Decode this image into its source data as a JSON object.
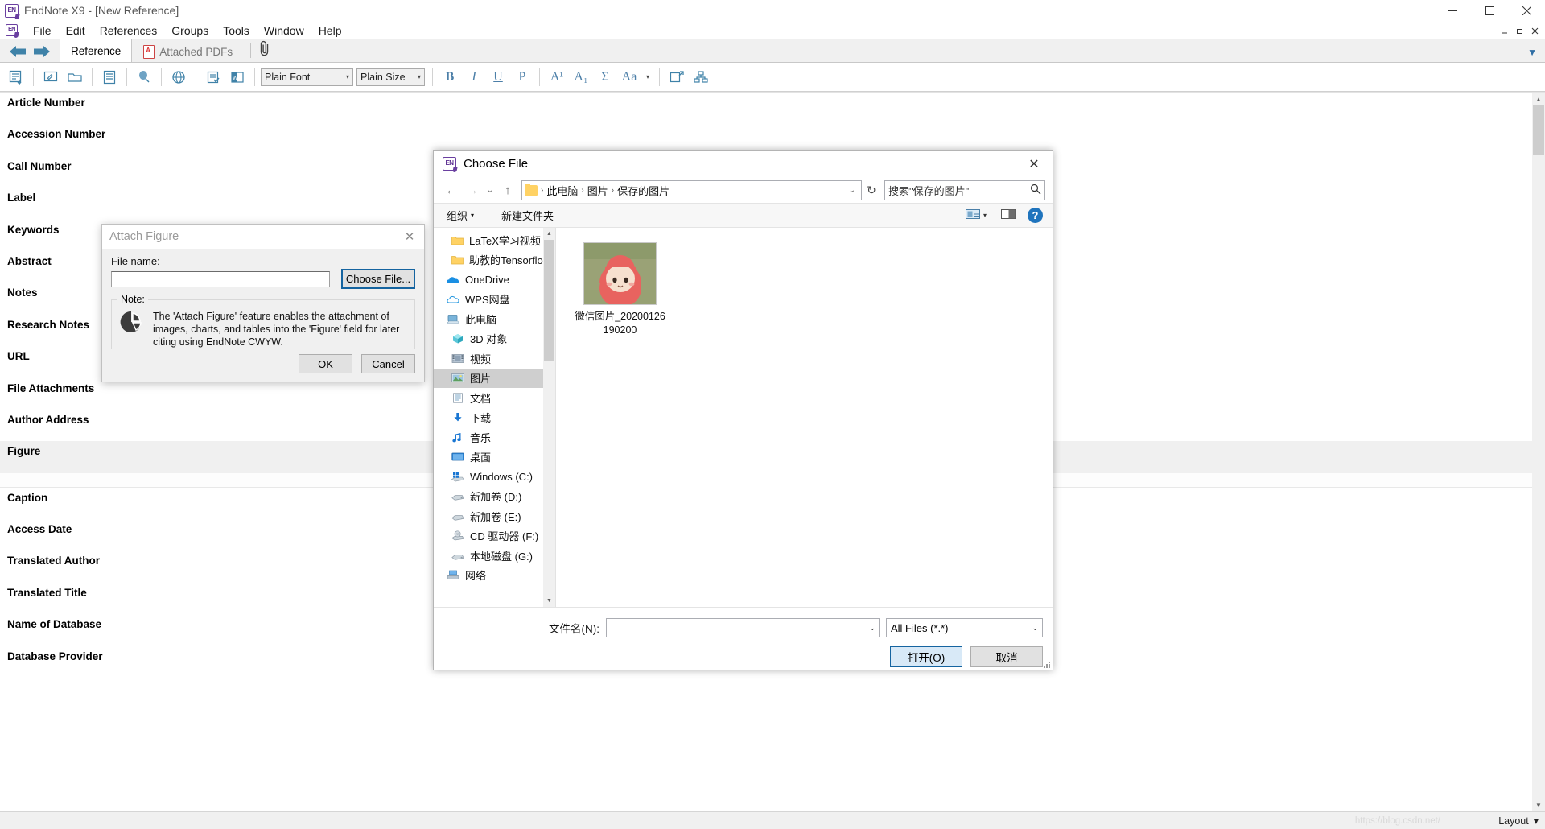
{
  "window": {
    "title": "EndNote X9 - [New Reference]",
    "app_logo": "EN",
    "controls": {
      "minimize": "—",
      "maximize": "❐",
      "close": "✕"
    },
    "mdi_controls": {
      "minimize": "—",
      "restore": "❐",
      "close": "✕"
    }
  },
  "menu": {
    "items": [
      "File",
      "Edit",
      "References",
      "Groups",
      "Tools",
      "Window",
      "Help"
    ]
  },
  "tabstrip": {
    "back": "back-arrow",
    "forward": "forward-arrow",
    "tabs": [
      {
        "label": "Reference",
        "active": true
      },
      {
        "label": "Attached PDFs",
        "active": false
      }
    ],
    "attachment_icon": "paperclip-icon",
    "collapse": "▼"
  },
  "toolbar": {
    "font_combo": {
      "value": "Plain Font"
    },
    "size_combo": {
      "value": "Plain Size"
    },
    "text_buttons": [
      "B",
      "I",
      "U",
      "P",
      "A¹",
      "A₁",
      "Σ",
      "Aa"
    ],
    "dropdown_caret": "▾"
  },
  "reference_fields": [
    "Article Number",
    "Accession Number",
    "Call Number",
    "Label",
    "Keywords",
    "Abstract",
    "Notes",
    "Research Notes",
    "URL",
    "File Attachments",
    "Author Address",
    "Figure",
    "Caption",
    "Access Date",
    "Translated Author",
    "Translated Title",
    "Name of Database",
    "Database Provider"
  ],
  "highlighted_field": "Figure",
  "statusbar": {
    "watermark": "https://blog.csdn.net/",
    "layout_label": "Layout",
    "layout_caret": "▾"
  },
  "attach_figure": {
    "title": "Attach Figure",
    "close": "✕",
    "file_name_label": "File name:",
    "file_name_value": "",
    "choose_button": "Choose File...",
    "note_legend": "Note:",
    "note_icon": "pie-chart-icon",
    "note_text": "The 'Attach Figure' feature enables the attachment of images, charts, and tables into the 'Figure' field for later citing using EndNote CWYW.",
    "ok_button": "OK",
    "cancel_button": "Cancel"
  },
  "choose_file": {
    "title": "Choose File",
    "app_logo": "EN",
    "close": "✕",
    "nav": {
      "back": "←",
      "forward": "→",
      "recent": "⌄",
      "up": "↑",
      "refresh": "↻"
    },
    "breadcrumb": {
      "folder_icon": "folder-icon",
      "items": [
        "此电脑",
        "图片",
        "保存的图片"
      ],
      "separator": "›",
      "caret": "⌄"
    },
    "search": {
      "placeholder": "搜索\"保存的图片\"",
      "value": "",
      "icon": "search-icon"
    },
    "commandbar": {
      "organize": "组织",
      "organize_caret": "▾",
      "new_folder": "新建文件夹",
      "view_icon": "view-layout-icon",
      "view_caret": "▾",
      "preview_icon": "preview-pane-icon",
      "help": "?"
    },
    "tree": [
      {
        "label": "LaTeX学习视频",
        "icon": "folder-icon",
        "indent": 2,
        "selected": false
      },
      {
        "label": "助教的Tensorflo",
        "icon": "folder-icon",
        "indent": 2,
        "selected": false
      },
      {
        "label": "OneDrive",
        "icon": "onedrive-icon",
        "indent": 1,
        "selected": false
      },
      {
        "label": "WPS网盘",
        "icon": "wps-cloud-icon",
        "indent": 1,
        "selected": false
      },
      {
        "label": "此电脑",
        "icon": "this-pc-icon",
        "indent": 1,
        "selected": false
      },
      {
        "label": "3D 对象",
        "icon": "3d-objects-icon",
        "indent": 2,
        "selected": false
      },
      {
        "label": "视频",
        "icon": "videos-icon",
        "indent": 2,
        "selected": false
      },
      {
        "label": "图片",
        "icon": "pictures-icon",
        "indent": 2,
        "selected": true
      },
      {
        "label": "文档",
        "icon": "documents-icon",
        "indent": 2,
        "selected": false
      },
      {
        "label": "下载",
        "icon": "downloads-icon",
        "indent": 2,
        "selected": false
      },
      {
        "label": "音乐",
        "icon": "music-icon",
        "indent": 2,
        "selected": false
      },
      {
        "label": "桌面",
        "icon": "desktop-icon",
        "indent": 2,
        "selected": false
      },
      {
        "label": "Windows (C:)",
        "icon": "windows-drive-icon",
        "indent": 2,
        "selected": false
      },
      {
        "label": "新加卷 (D:)",
        "icon": "drive-icon",
        "indent": 2,
        "selected": false
      },
      {
        "label": "新加卷 (E:)",
        "icon": "drive-icon",
        "indent": 2,
        "selected": false
      },
      {
        "label": "CD 驱动器 (F:)",
        "icon": "cd-drive-icon",
        "indent": 2,
        "selected": false
      },
      {
        "label": "本地磁盘 (G:)",
        "icon": "drive-icon",
        "indent": 2,
        "selected": false
      },
      {
        "label": "网络",
        "icon": "network-icon",
        "indent": 1,
        "selected": false
      }
    ],
    "files": [
      {
        "name": "微信图片_20200126190200",
        "thumbnail": "cartoon-girl-red-hood"
      }
    ],
    "footer": {
      "filename_label": "文件名(N):",
      "filename_value": "",
      "filename_caret": "⌄",
      "filetype_value": "All Files (*.*)",
      "filetype_caret": "⌄",
      "open_button": "打开(O)",
      "cancel_button": "取消"
    }
  }
}
